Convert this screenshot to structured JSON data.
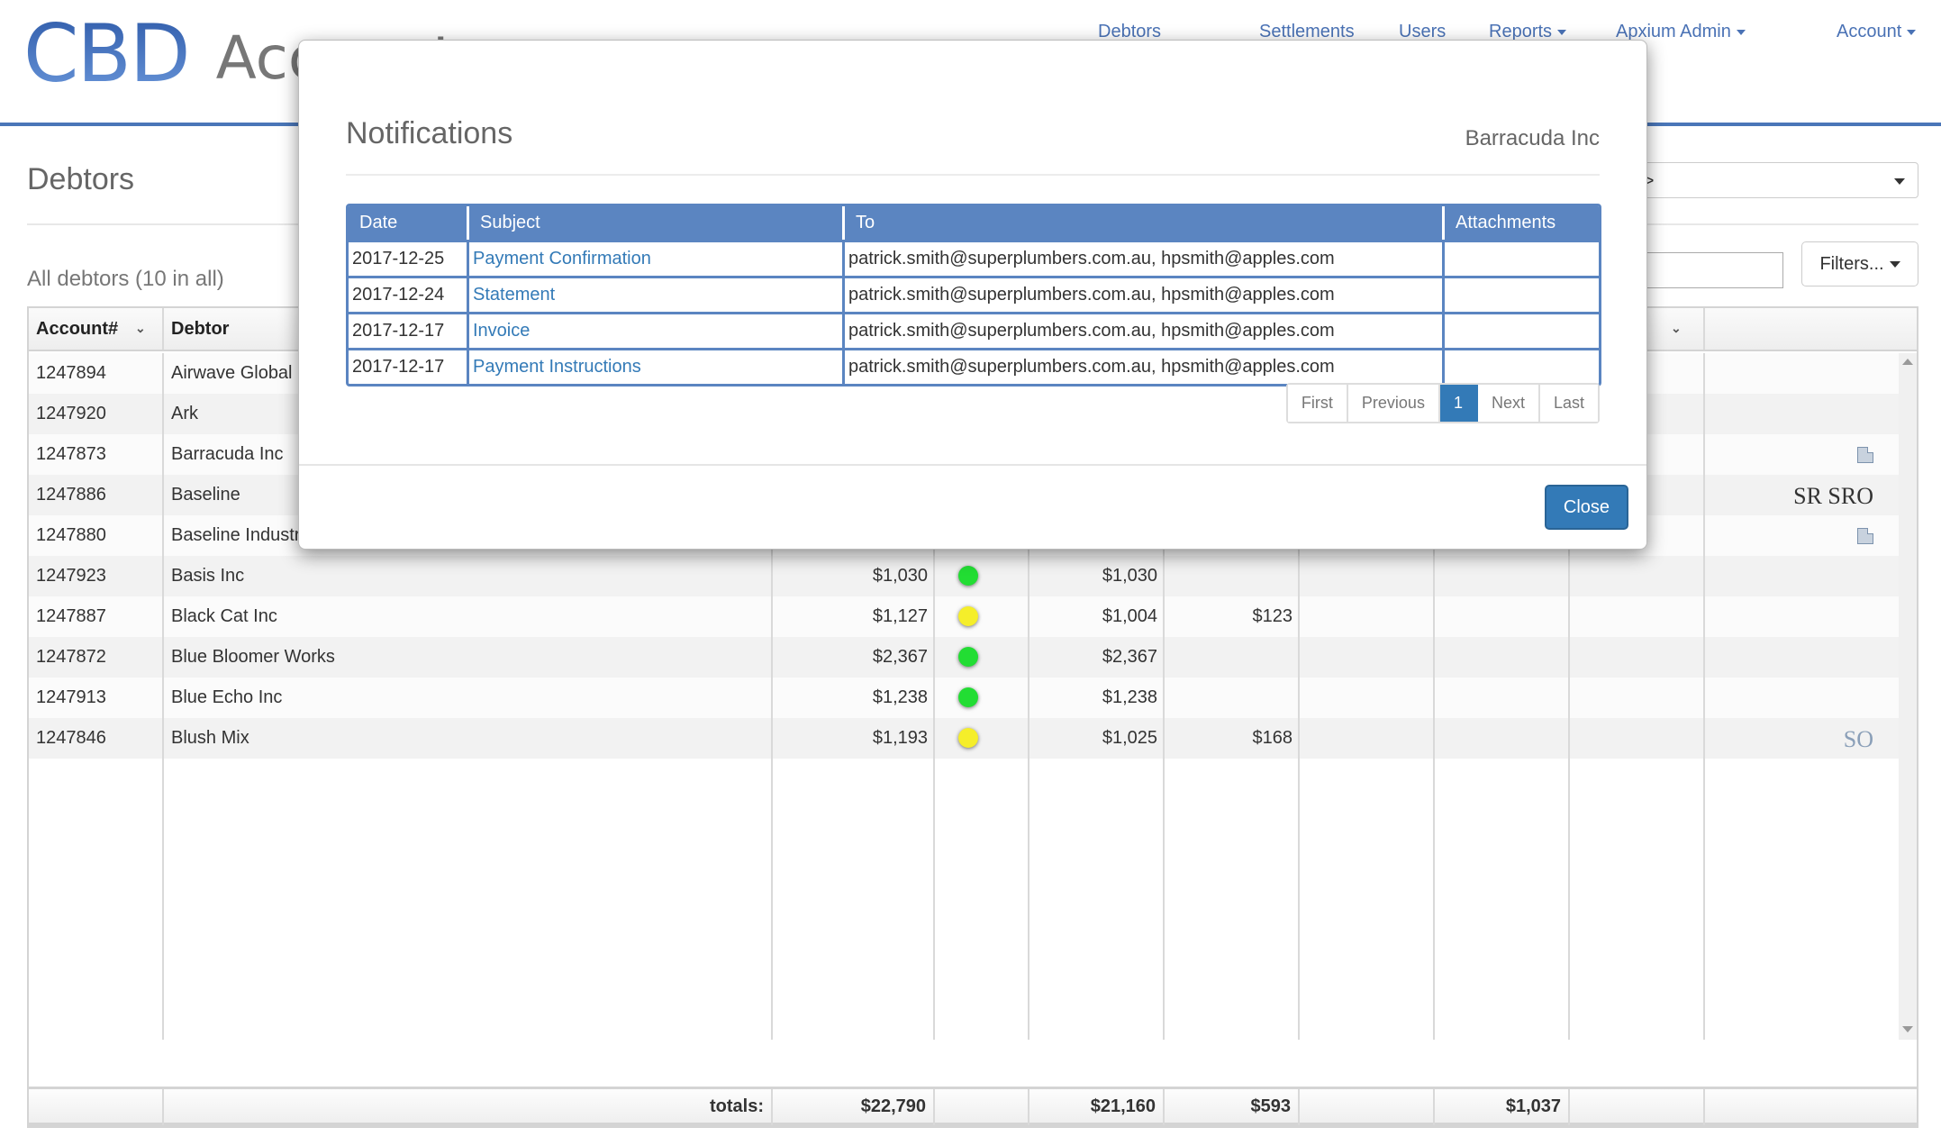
{
  "header": {
    "logo_mark": "CBD",
    "app_name": "Accounts",
    "nav": [
      {
        "label": "Debtors",
        "dropdown": false
      },
      {
        "label": "Settlements",
        "dropdown": false
      },
      {
        "label": "Users",
        "dropdown": false
      },
      {
        "label": "Reports",
        "dropdown": true
      },
      {
        "label": "Apxium Admin",
        "dropdown": true
      },
      {
        "label": "Account",
        "dropdown": true
      }
    ]
  },
  "page": {
    "title": "Debtors",
    "status_select_value": "<all>",
    "summary": "All debtors (10 in all)",
    "search_value": "",
    "filters_label": "Filters..."
  },
  "grid": {
    "columns": [
      "Account#",
      "Debtor",
      "",
      "",
      "",
      "",
      "",
      "",
      "",
      "",
      ""
    ],
    "rows": [
      {
        "account": "1247894",
        "debtor": "Airwave Global",
        "balance": "",
        "status": "",
        "current": "",
        "overdue": "",
        "c6": "",
        "c7": "",
        "c8": "",
        "flags": "",
        "doc": false
      },
      {
        "account": "1247920",
        "debtor": "Ark",
        "balance": "",
        "status": "",
        "current": "",
        "overdue": "",
        "c6": "",
        "c7": "",
        "c8": "",
        "flags": "",
        "doc": false
      },
      {
        "account": "1247873",
        "debtor": "Barracuda Inc",
        "balance": "",
        "status": "",
        "current": "",
        "overdue": "",
        "c6": "",
        "c7": "",
        "c8": "",
        "flags": "",
        "doc": true
      },
      {
        "account": "1247886",
        "debtor": "Baseline",
        "balance": "",
        "status": "",
        "current": "",
        "overdue": "",
        "c6": "",
        "c7": "",
        "c8": "",
        "flags": "SR SRO",
        "doc": false
      },
      {
        "account": "1247880",
        "debtor": "Baseline Industries",
        "balance": "",
        "status": "",
        "current": "",
        "overdue": "",
        "c6": "",
        "c7": "",
        "c8": "",
        "flags": "",
        "doc": true
      },
      {
        "account": "1247923",
        "debtor": "Basis Inc",
        "balance": "$1,030",
        "status": "green",
        "current": "$1,030",
        "overdue": "",
        "c6": "",
        "c7": "",
        "c8": "",
        "flags": "",
        "doc": false
      },
      {
        "account": "1247887",
        "debtor": "Black Cat Inc",
        "balance": "$1,127",
        "status": "yellow",
        "current": "$1,004",
        "overdue": "$123",
        "c6": "",
        "c7": "",
        "c8": "",
        "flags": "",
        "doc": false
      },
      {
        "account": "1247872",
        "debtor": "Blue Bloomer Works",
        "balance": "$2,367",
        "status": "green",
        "current": "$2,367",
        "overdue": "",
        "c6": "",
        "c7": "",
        "c8": "",
        "flags": "",
        "doc": false
      },
      {
        "account": "1247913",
        "debtor": "Blue Echo Inc",
        "balance": "$1,238",
        "status": "green",
        "current": "$1,238",
        "overdue": "",
        "c6": "",
        "c7": "",
        "c8": "",
        "flags": "",
        "doc": false
      },
      {
        "account": "1247846",
        "debtor": "Blush Mix",
        "balance": "$1,193",
        "status": "yellow",
        "current": "$1,025",
        "overdue": "$168",
        "c6": "",
        "c7": "",
        "c8": "",
        "flags": "SO",
        "doc": false
      }
    ],
    "totals": {
      "label": "totals:",
      "balance": "$22,790",
      "current": "$21,160",
      "overdue": "$593",
      "c6": "",
      "c7": "$1,037",
      "c8": ""
    }
  },
  "colors": {
    "accent": "#4a76b8",
    "link": "#337ab7",
    "status_green": "#22dd33",
    "status_yellow": "#f5ee2a",
    "modal_table_border": "#5b85c1"
  },
  "modal": {
    "title": "Notifications",
    "subtitle": "Barracuda Inc",
    "columns": [
      "Date",
      "Subject",
      "To",
      "Attachments"
    ],
    "rows": [
      {
        "date": "2017-12-25",
        "subject": "Payment Confirmation",
        "to": "patrick.smith@superplumbers.com.au, hpsmith@apples.com",
        "attachments": ""
      },
      {
        "date": "2017-12-24",
        "subject": "Statement",
        "to": "patrick.smith@superplumbers.com.au, hpsmith@apples.com",
        "attachments": ""
      },
      {
        "date": "2017-12-17",
        "subject": "Invoice",
        "to": "patrick.smith@superplumbers.com.au, hpsmith@apples.com",
        "attachments": ""
      },
      {
        "date": "2017-12-17",
        "subject": "Payment Instructions",
        "to": "patrick.smith@superplumbers.com.au, hpsmith@apples.com",
        "attachments": ""
      }
    ],
    "pager": {
      "first": "First",
      "previous": "Previous",
      "current": "1",
      "next": "Next",
      "last": "Last"
    },
    "close_label": "Close"
  }
}
